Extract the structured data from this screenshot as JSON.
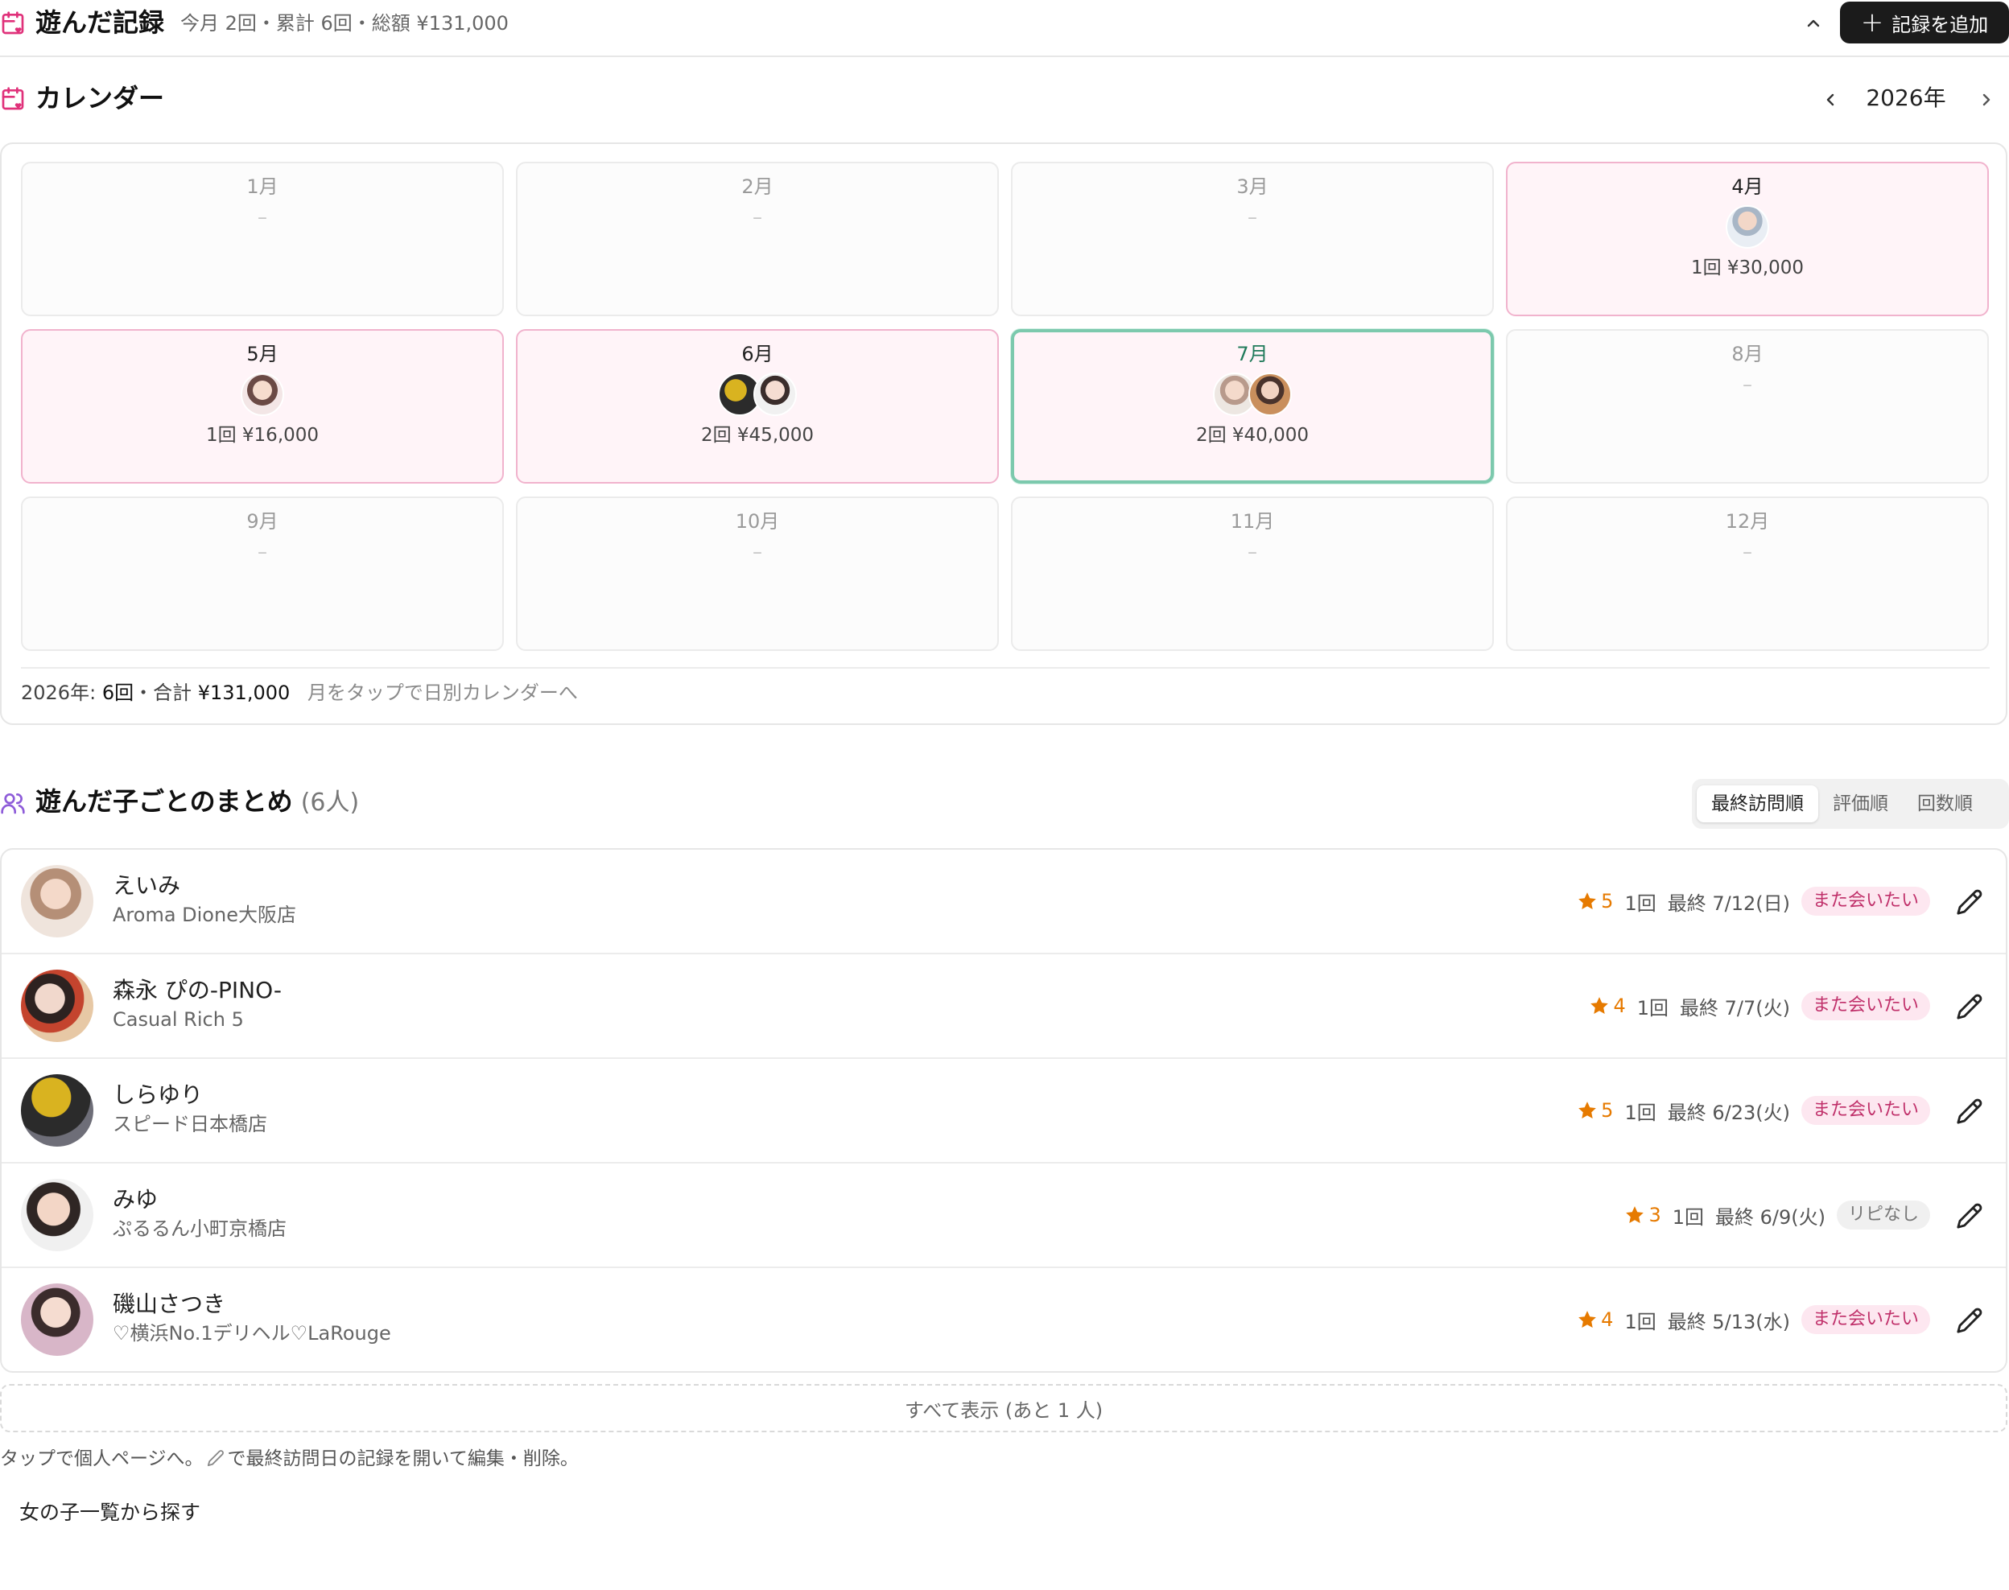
{
  "header": {
    "title": "遊んだ記録",
    "summary": "今月 2回・累計 6回・総額 ¥131,000",
    "add_label": "記録を追加"
  },
  "calendar": {
    "title": "カレンダー",
    "year_label": "2026年",
    "months": [
      {
        "label": "1月",
        "placeholder": "–"
      },
      {
        "label": "2月",
        "placeholder": "–"
      },
      {
        "label": "3月",
        "placeholder": "–"
      },
      {
        "label": "4月",
        "stat": "1回 ¥30,000"
      },
      {
        "label": "5月",
        "stat": "1回 ¥16,000"
      },
      {
        "label": "6月",
        "stat": "2回 ¥45,000"
      },
      {
        "label": "7月",
        "stat": "2回 ¥40,000"
      },
      {
        "label": "8月",
        "placeholder": "–"
      },
      {
        "label": "9月",
        "placeholder": "–"
      },
      {
        "label": "10月",
        "placeholder": "–"
      },
      {
        "label": "11月",
        "placeholder": "–"
      },
      {
        "label": "12月",
        "placeholder": "–"
      }
    ],
    "footer": {
      "year": "2026年:",
      "count": "6回",
      "sep": "・合計",
      "total": "¥131,000",
      "hint": "月をタップで日別カレンダーへ"
    }
  },
  "summary": {
    "title": "遊んだ子ごとのまとめ",
    "count": "(6人)",
    "sort": [
      "最終訪問順",
      "評価順",
      "回数順"
    ],
    "rows": [
      {
        "name": "えいみ",
        "shop": "Aroma Dione大阪店",
        "rating": "5",
        "visits": "1回",
        "last": "最終 7/12(日)",
        "status": "また会いたい"
      },
      {
        "name": "森永 ぴの-PINO-",
        "shop": "Casual Rich 5",
        "rating": "4",
        "visits": "1回",
        "last": "最終 7/7(火)",
        "status": "また会いたい"
      },
      {
        "name": "しらゆり",
        "shop": "スピード日本橋店",
        "rating": "5",
        "visits": "1回",
        "last": "最終 6/23(火)",
        "status": "また会いたい"
      },
      {
        "name": "みゆ",
        "shop": "ぷるるん小町京橋店",
        "rating": "3",
        "visits": "1回",
        "last": "最終 6/9(火)",
        "status": "リピなし"
      },
      {
        "name": "磯山さつき",
        "shop": "♡横浜No.1デリヘル♡LaRouge",
        "rating": "4",
        "visits": "1回",
        "last": "最終 5/13(水)",
        "status": "また会いたい"
      }
    ],
    "show_all": "すべて表示 (あと 1 人)",
    "note_before": "タップで個人ページへ。",
    "note_after": "で最終訪問日の記録を開いて編集・削除。",
    "search_link": "女の子一覧から探す"
  },
  "colors": {
    "accent_pink": "#e0317a",
    "accent_purple": "#8e5cd9",
    "star_orange": "#e67a00",
    "current_month_border": "#7cc9ad",
    "active_month_bg": "#fff4f8",
    "add_button_bg": "#1b1b1b"
  },
  "icons": {
    "header": "calendar-heart-icon",
    "calendar": "calendar-heart-icon",
    "summary": "users-icon",
    "collapse": "chevron-up-icon",
    "edit": "pencil-icon"
  }
}
